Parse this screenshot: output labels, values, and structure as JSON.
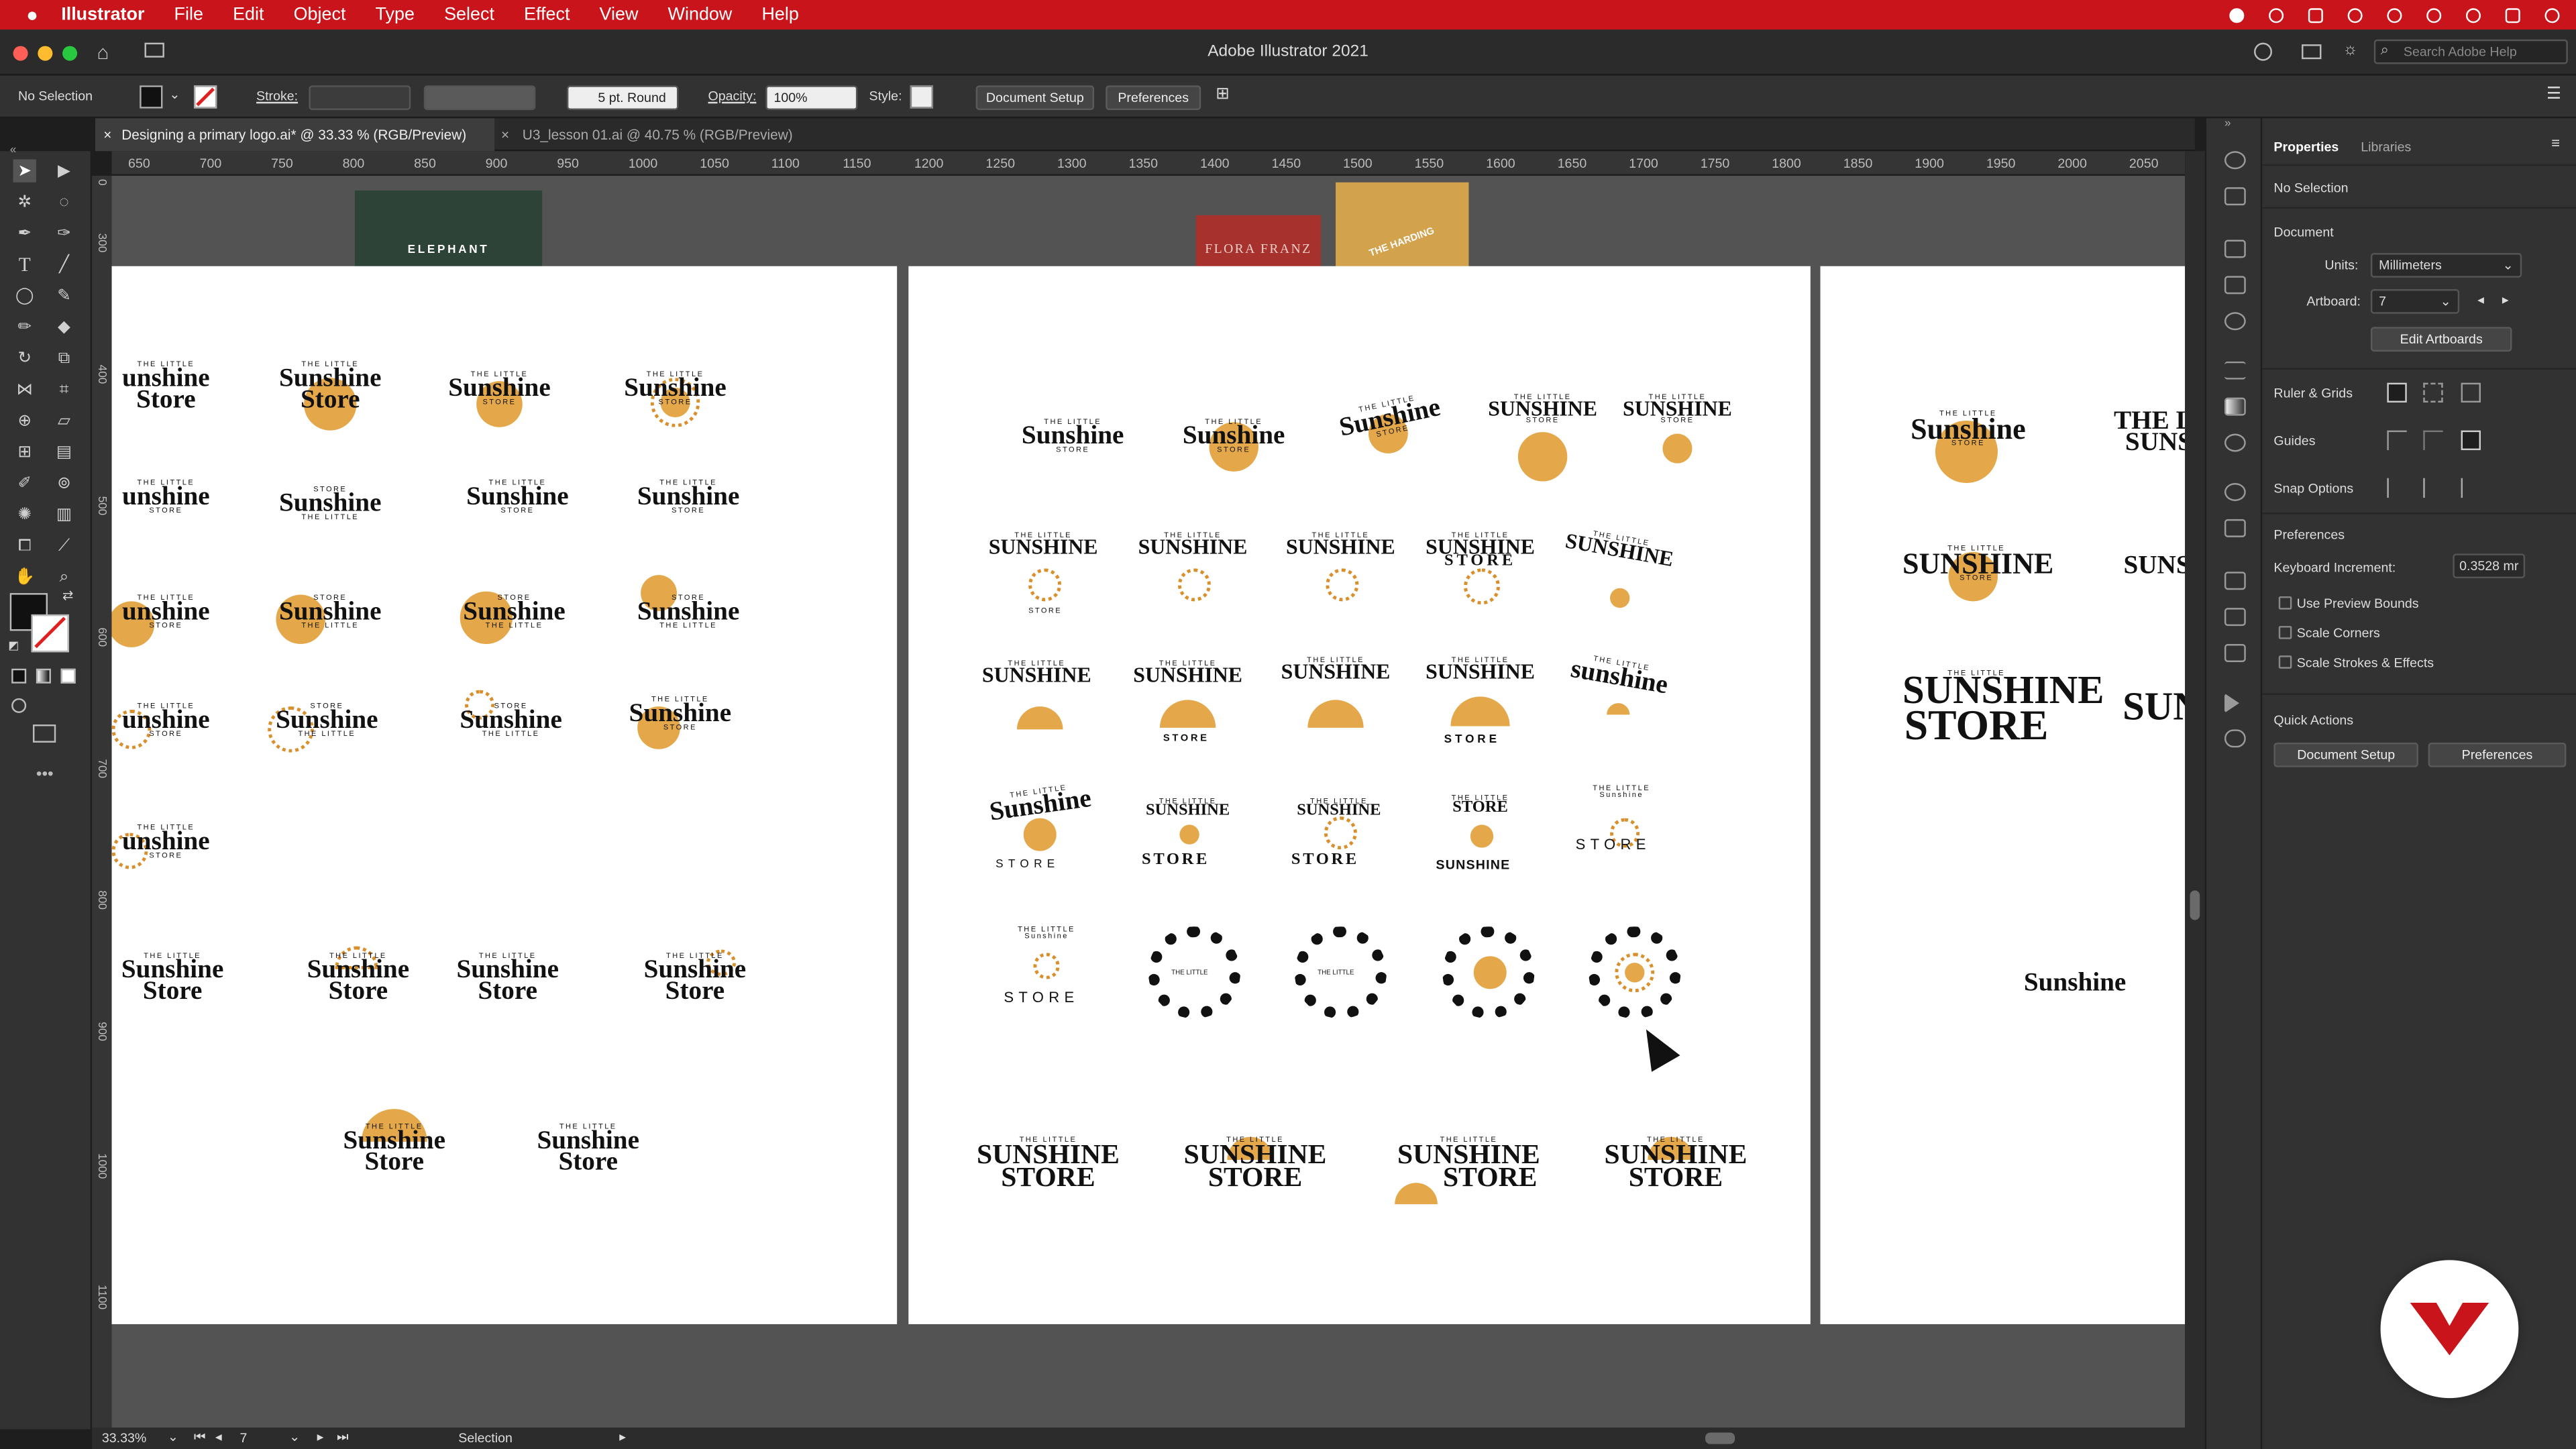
{
  "menubar": {
    "apple": "",
    "items": [
      "Illustrator",
      "File",
      "Edit",
      "Object",
      "Type",
      "Select",
      "Effect",
      "View",
      "Window",
      "Help"
    ]
  },
  "window": {
    "title": "Adobe Illustrator 2021",
    "search_placeholder": "Search Adobe Help"
  },
  "control": {
    "selection": "No Selection",
    "stroke_label": "Stroke:",
    "brush": "5 pt. Round",
    "opacity_label": "Opacity:",
    "opacity": "100%",
    "style_label": "Style:",
    "doc_setup": "Document Setup",
    "preferences": "Preferences"
  },
  "tabs": [
    {
      "label": "Designing a primary logo.ai* @ 33.33 % (RGB/Preview)",
      "active": true
    },
    {
      "label": "U3_lesson 01.ai @ 40.75 % (RGB/Preview)",
      "active": false
    }
  ],
  "ruler": {
    "h": [
      "650",
      "700",
      "750",
      "800",
      "850",
      "900",
      "950",
      "1000",
      "1050",
      "1100",
      "1150",
      "1200",
      "1250",
      "1300",
      "1350",
      "1400",
      "1450",
      "1500",
      "1550",
      "1600",
      "1650",
      "1700",
      "1750",
      "1800",
      "1850",
      "1900",
      "1950",
      "2000",
      "2050"
    ],
    "v": [
      "0",
      "300",
      "400",
      "500",
      "600",
      "700",
      "800",
      "900",
      "1000",
      "1100"
    ]
  },
  "status": {
    "zoom": "33.33%",
    "artboard": "7",
    "tool": "Selection"
  },
  "props": {
    "tabs": [
      "Properties",
      "Libraries"
    ],
    "selection": "No Selection",
    "document": "Document",
    "units_label": "Units:",
    "units": "Millimeters",
    "artboard_label": "Artboard:",
    "artboard": "7",
    "edit_artboards": "Edit Artboards",
    "ruler_grids": "Ruler & Grids",
    "guides": "Guides",
    "snap": "Snap Options",
    "preferences_h": "Preferences",
    "key_inc_label": "Keyboard Increment:",
    "key_inc": "0.3528 mr",
    "use_preview": "Use Preview Bounds",
    "scale_corners": "Scale Corners",
    "scale_strokes": "Scale Strokes & Effects",
    "quick_actions": "Quick Actions",
    "qa_doc_setup": "Document Setup",
    "qa_preferences": "Preferences"
  },
  "artwork": {
    "elephant_title": "ELEPHANT",
    "flora": "FLORA FRANZ",
    "harding": "THE HARDING",
    "small": "THE LITTLE",
    "store": "STORE",
    "sunshine": "Sunshine",
    "SUNSHINE": "SUNSHINE",
    "sunshine_lc": "sunshine",
    "partial": "unshine",
    "partial_upper": "SUNS",
    "store_cap": "Store",
    "THE_LI": "THE LI"
  },
  "colors": {
    "brand_red": "#c8141a",
    "sun": "#e4a84a",
    "dark_green": "#2e4337",
    "flora_red": "#a7312d",
    "harding_gold": "#d3a24c"
  }
}
